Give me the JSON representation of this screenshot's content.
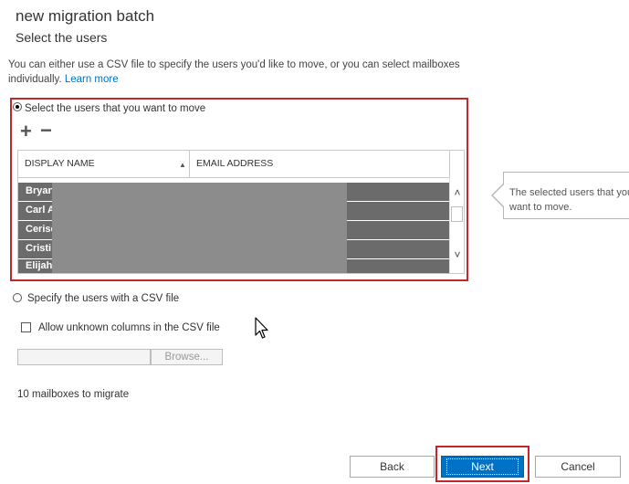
{
  "wizard": {
    "title": "new migration batch",
    "subtitle": "Select the users",
    "description": "You can either use a CSV file to specify the users you'd like to move, or you can select mailboxes individually.",
    "learn_more": "Learn more"
  },
  "select_users": {
    "radio_label": "Select the users that you want to move",
    "add_label": "+",
    "remove_label": "−",
    "columns": [
      "DISPLAY NAME",
      "EMAIL ADDRESS"
    ],
    "sort_indicator": "▲",
    "rows": [
      {
        "display_name": "Bryan"
      },
      {
        "display_name": "Carl A"
      },
      {
        "display_name": "Cerise"
      },
      {
        "display_name": "Cristi"
      },
      {
        "display_name": "Elijah"
      }
    ],
    "scroll_up": "˄",
    "scroll_down": "˅"
  },
  "callout": {
    "text": "The selected users that you want to move."
  },
  "csv": {
    "radio_label": "Specify the users with a CSV file",
    "checkbox_label": "Allow unknown columns in the CSV file",
    "file_value": "",
    "browse_label": "Browse..."
  },
  "status": {
    "count_text": "10 mailboxes to migrate"
  },
  "footer": {
    "back_label": "Back",
    "next_label": "Next",
    "cancel_label": "Cancel"
  },
  "colors": {
    "accent": "#0072c6",
    "highlight_frame": "#c4262e",
    "row_selected": "#6b6b6b"
  }
}
